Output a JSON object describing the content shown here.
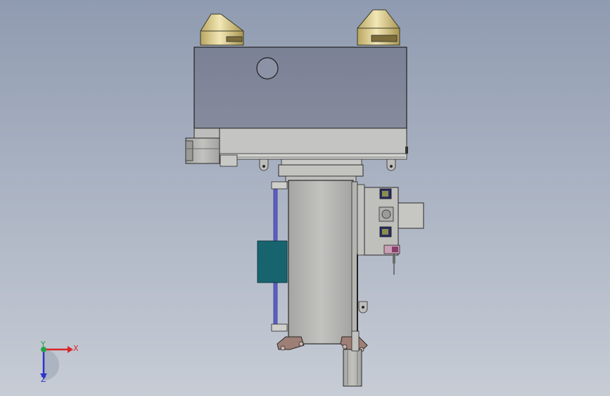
{
  "triad": {
    "x_label": "X",
    "y_label": "Y",
    "z_label": "Z",
    "x_color": "#d8262a",
    "y_color": "#2aa14a",
    "z_color": "#2b34c8"
  },
  "palette": {
    "background_top": "#8f9bb0",
    "background_bottom": "#c7ccd5",
    "housing": "#7f8599",
    "metal": "#b7b7b4",
    "cone": "#e2d49a",
    "teal_box": "#17646f",
    "rod": "#5d5fc3",
    "bracket": "#9e7f75"
  }
}
